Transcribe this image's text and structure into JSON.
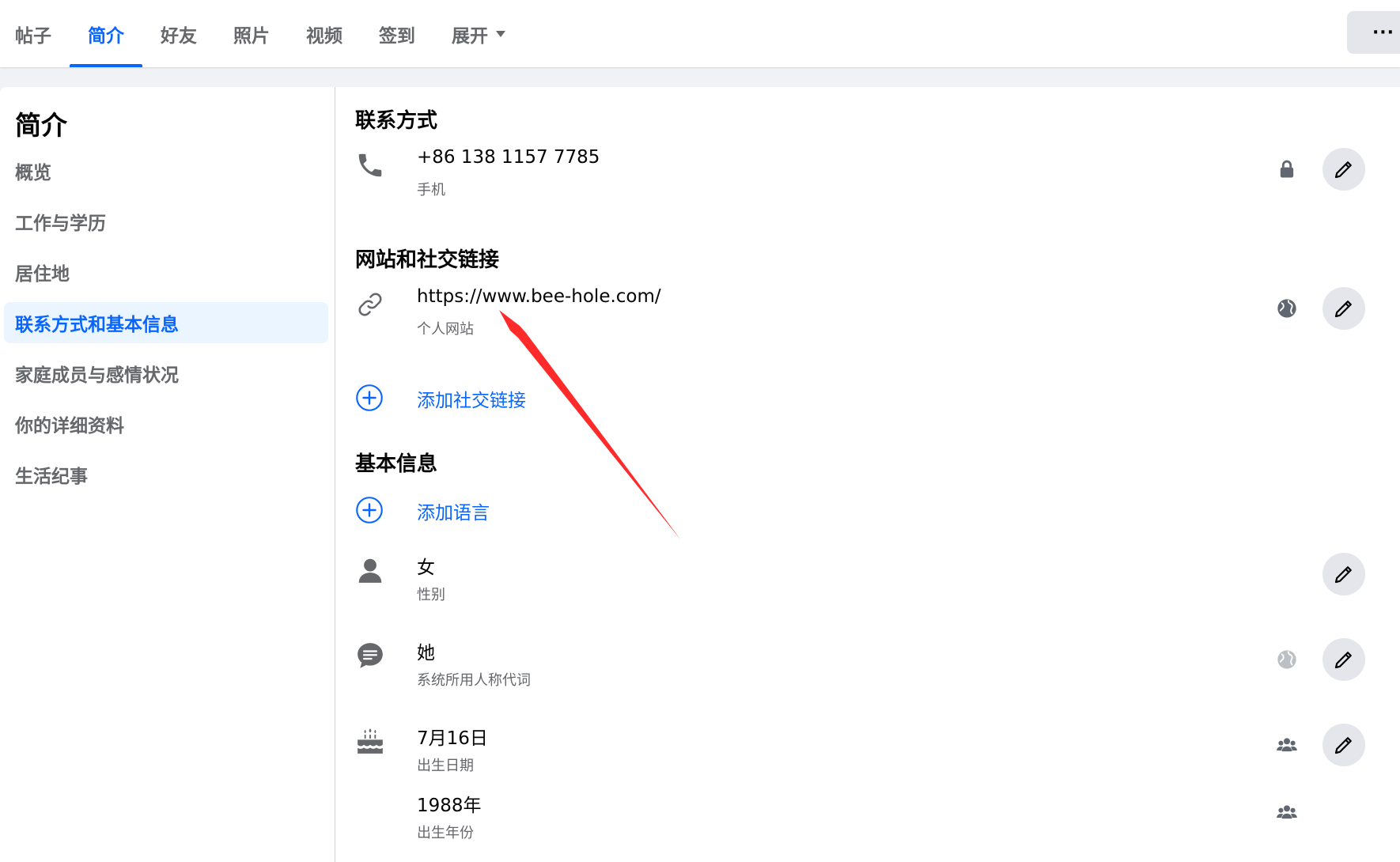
{
  "tabs": [
    {
      "label": "帖子"
    },
    {
      "label": "简介"
    },
    {
      "label": "好友"
    },
    {
      "label": "照片"
    },
    {
      "label": "视频"
    },
    {
      "label": "签到"
    },
    {
      "label": "展开"
    }
  ],
  "more_label": "···",
  "sidebar": {
    "title": "简介",
    "items": [
      {
        "label": "概览"
      },
      {
        "label": "工作与学历"
      },
      {
        "label": "居住地"
      },
      {
        "label": "联系方式和基本信息"
      },
      {
        "label": "家庭成员与感情状况"
      },
      {
        "label": "你的详细资料"
      },
      {
        "label": "生活纪事"
      }
    ]
  },
  "contact": {
    "title": "联系方式",
    "phone": {
      "value": "+86 138 1157 7785",
      "sub": "手机",
      "privacy": "lock-icon"
    }
  },
  "websites": {
    "title": "网站和社交链接",
    "site": {
      "value": "https://www.bee-hole.com/",
      "sub": "个人网站",
      "privacy": "globe-icon"
    },
    "add_social": "添加社交链接"
  },
  "basic": {
    "title": "基本信息",
    "add_language": "添加语言",
    "gender": {
      "value": "女",
      "sub": "性别"
    },
    "pronoun": {
      "value": "她",
      "sub": "系统所用人称代词",
      "privacy": "globe-icon"
    },
    "birthday": {
      "value": "7月16日",
      "sub": "出生日期",
      "privacy": "friends-icon"
    },
    "birthyear": {
      "value": "1988年",
      "sub": "出生年份",
      "privacy": "friends-icon"
    }
  },
  "colors": {
    "accent": "#0866ff",
    "annotation": "#ff2a2a",
    "secondary_text": "#65676b"
  }
}
